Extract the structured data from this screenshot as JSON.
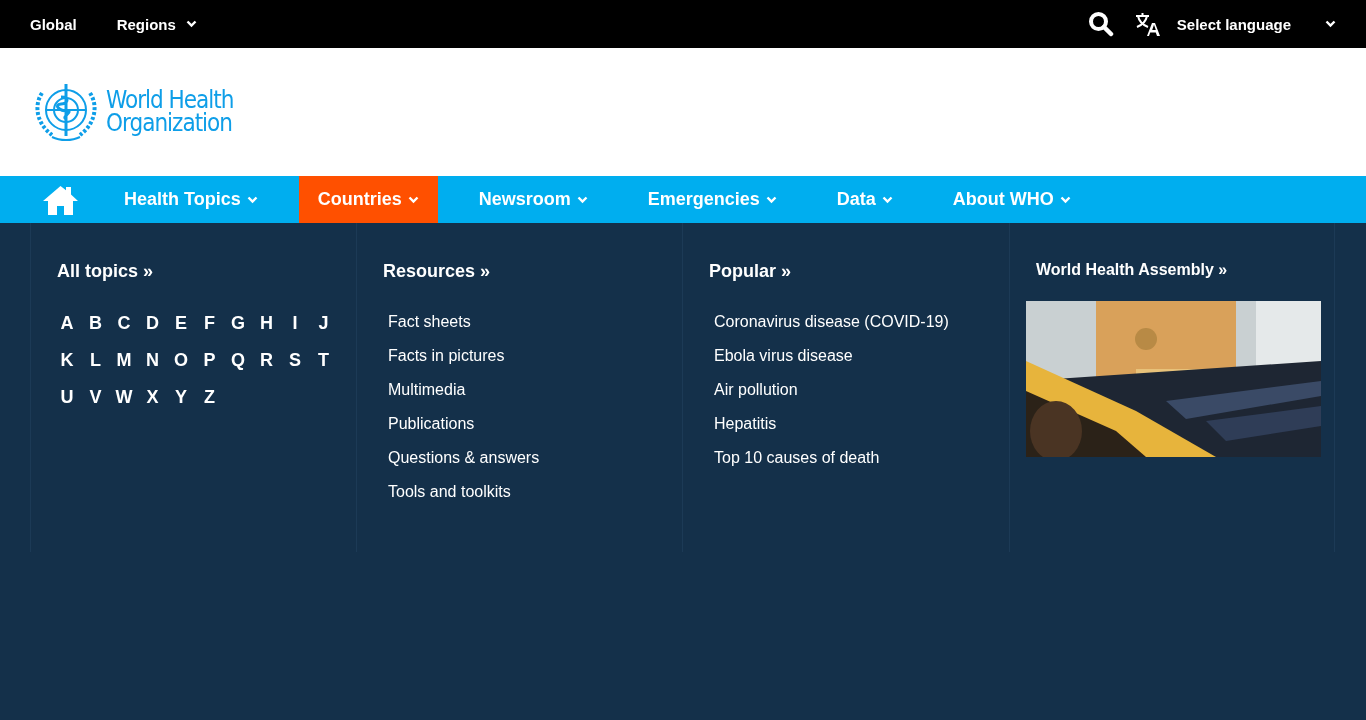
{
  "top_bar": {
    "links": [
      {
        "label": "Global",
        "has_dropdown": false
      },
      {
        "label": "Regions",
        "has_dropdown": true
      }
    ],
    "language": "Select language"
  },
  "logo": {
    "line_1": "World Health",
    "line_2": "Organization"
  },
  "nav": [
    {
      "label": "Health Topics",
      "selected": false
    },
    {
      "label": "Countries",
      "selected": true
    },
    {
      "label": "Newsroom",
      "selected": false
    },
    {
      "label": "Emergencies",
      "selected": false
    },
    {
      "label": "Data",
      "selected": false
    },
    {
      "label": "About WHO",
      "selected": false
    }
  ],
  "menu": {
    "all_topics": {
      "heading": "All topics »",
      "letters": [
        "A",
        "B",
        "C",
        "D",
        "E",
        "F",
        "G",
        "H",
        "I",
        "J",
        "K",
        "L",
        "M",
        "N",
        "O",
        "P",
        "Q",
        "R",
        "S",
        "T",
        "U",
        "V",
        "W",
        "X",
        "Y",
        "Z"
      ]
    },
    "resources": {
      "heading": "Resources »",
      "links": [
        "Fact sheets",
        "Facts in pictures",
        "Multimedia",
        "Publications",
        "Questions & answers",
        "Tools and toolkits"
      ]
    },
    "popular": {
      "heading": "Popular »",
      "links": [
        "Coronavirus disease (COVID-19)",
        "Ebola virus disease",
        "Air pollution",
        "Hepatitis",
        "Top 10 causes of death"
      ]
    },
    "assembly": {
      "heading": "World Health Assembly »"
    }
  }
}
